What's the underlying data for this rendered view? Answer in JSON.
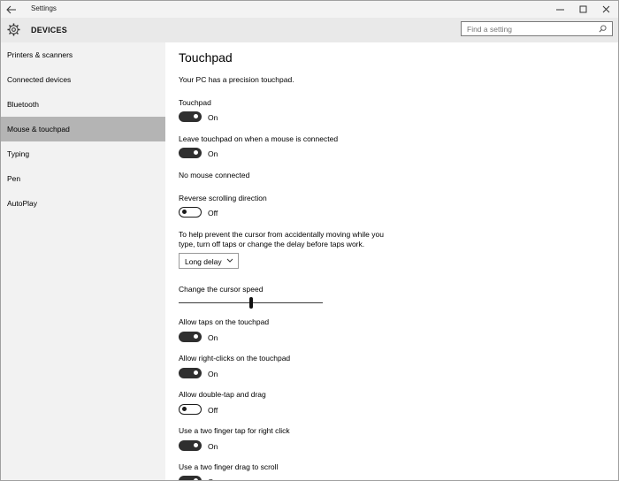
{
  "window": {
    "title": "Settings"
  },
  "header": {
    "section_title": "DEVICES",
    "search_placeholder": "Find a setting"
  },
  "sidebar": {
    "items": [
      {
        "label": "Printers & scanners",
        "active": false
      },
      {
        "label": "Connected devices",
        "active": false
      },
      {
        "label": "Bluetooth",
        "active": false
      },
      {
        "label": "Mouse & touchpad",
        "active": true
      },
      {
        "label": "Typing",
        "active": false
      },
      {
        "label": "Pen",
        "active": false
      },
      {
        "label": "AutoPlay",
        "active": false
      }
    ]
  },
  "content": {
    "title": "Touchpad",
    "precision_note": "Your PC has a precision touchpad.",
    "touchpad": {
      "label": "Touchpad",
      "state": "On"
    },
    "leave_on": {
      "label": "Leave touchpad on when a mouse is connected",
      "state": "On"
    },
    "no_mouse": "No mouse connected",
    "reverse_scroll": {
      "label": "Reverse scrolling direction",
      "state": "Off"
    },
    "delay_help_line1": "To help prevent the cursor from accidentally moving while you",
    "delay_help_line2": "type, turn off taps or change the delay before taps work.",
    "delay_dropdown": {
      "value": "Long delay"
    },
    "cursor_speed": {
      "label": "Change the cursor speed",
      "value_fraction": 0.5
    },
    "allow_taps": {
      "label": "Allow taps on the touchpad",
      "state": "On"
    },
    "right_clicks": {
      "label": "Allow right-clicks on the touchpad",
      "state": "On"
    },
    "double_tap": {
      "label": "Allow double-tap and drag",
      "state": "Off"
    },
    "two_finger_tap": {
      "label": "Use a two finger tap for right click",
      "state": "On"
    },
    "two_finger_drag": {
      "label": "Use a two finger drag to scroll",
      "state": "On"
    }
  }
}
